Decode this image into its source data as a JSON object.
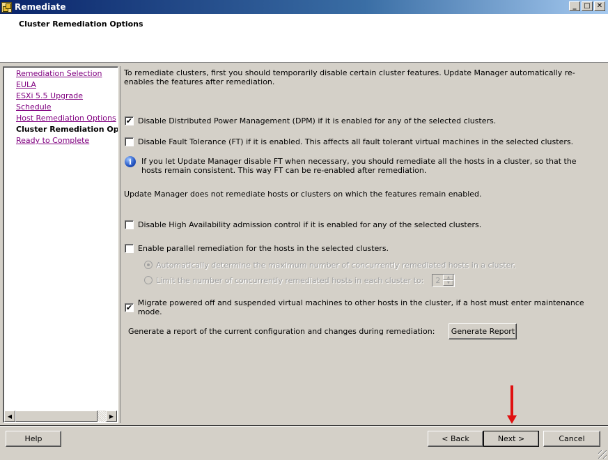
{
  "window": {
    "title": "Remediate",
    "controls": {
      "minimize": "_",
      "maximize": "□",
      "close": "✕"
    }
  },
  "header": {
    "title": "Cluster Remediation Options"
  },
  "nav": {
    "items": [
      {
        "label": "Remediation Selection",
        "current": false
      },
      {
        "label": "EULA",
        "current": false
      },
      {
        "label": "ESXi 5.5 Upgrade",
        "current": false
      },
      {
        "label": "Schedule",
        "current": false
      },
      {
        "label": "Host Remediation Options",
        "current": false
      },
      {
        "label": "Cluster Remediation Options",
        "current": true
      },
      {
        "label": "Ready to Complete",
        "current": false
      }
    ],
    "scroll_left": "◀",
    "scroll_right": "▶"
  },
  "content": {
    "intro": "To remediate clusters, first you should temporarily disable certain cluster features. Update Manager automatically re-enables the features after remediation.",
    "options": {
      "dpm": {
        "label": "Disable Distributed Power Management (DPM) if it is enabled for any of the selected clusters.",
        "checked": true,
        "mark": "✔"
      },
      "ft": {
        "label": "Disable Fault Tolerance (FT) if it is enabled. This affects all fault tolerant virtual machines in the selected clusters.",
        "checked": false,
        "mark": ""
      },
      "ha": {
        "label": "Disable High Availability admission control if it is enabled for any of the selected clusters.",
        "checked": false,
        "mark": ""
      },
      "parallel": {
        "label": "Enable parallel remediation for the hosts in the selected clusters.",
        "checked": false,
        "mark": ""
      },
      "migrate": {
        "label": "Migrate powered off and suspended virtual machines to other hosts in the cluster, if a host must enter maintenance mode.",
        "checked": true,
        "mark": "✔"
      }
    },
    "info_icon": "i",
    "info_text": "If you let Update Manager disable FT when necessary, you should remediate all the hosts in a cluster, so that the hosts remain consistent. This way FT can be re-enabled after remediation.",
    "note": "Update Manager does not remediate hosts or clusters on which the features remain enabled.",
    "parallel_modes": {
      "auto": {
        "label": "Automatically determine the maximum number of concurrently remediated hosts in a cluster.",
        "selected": true,
        "disabled": true
      },
      "limit": {
        "label": "Limit the number of concurrently remediated hosts in each cluster to:",
        "selected": false,
        "disabled": true,
        "value": "2",
        "up": "▲",
        "down": "▼"
      }
    },
    "report": {
      "label": "Generate a report of the current configuration and changes during remediation:",
      "button": "Generate Report"
    }
  },
  "footer": {
    "help": "Help",
    "back": "< Back",
    "next": "Next >",
    "cancel": "Cancel"
  },
  "annotation": {
    "type": "red-arrow",
    "color": "#e01010",
    "points_to": "Next >"
  }
}
